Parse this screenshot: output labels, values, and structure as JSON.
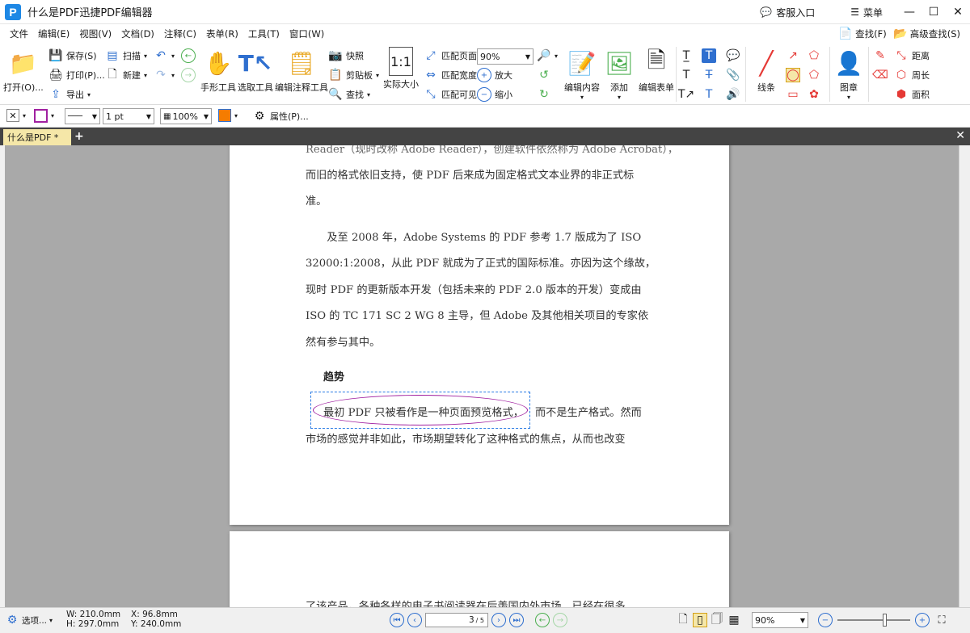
{
  "window": {
    "title": "什么是PDF迅捷PDF编辑器",
    "service_label": "客服入口",
    "menu_label": "菜单"
  },
  "menubar": {
    "items": [
      "文件",
      "编辑(E)",
      "视图(V)",
      "文档(D)",
      "注释(C)",
      "表单(R)",
      "工具(T)",
      "窗口(W)"
    ],
    "find": "查找(F)",
    "advanced_find": "高级查找(S)"
  },
  "ribbon": {
    "open": "打开(O)...",
    "save": "保存(S)",
    "print": "打印(P)...",
    "export": "导出",
    "scan": "扫描",
    "new": "新建",
    "hand_tool": "手形工具",
    "select_tool": "选取工具",
    "edit_annot_tool": "编辑注释工具",
    "snapshot": "快照",
    "clipboard": "剪贴板",
    "find": "查找",
    "actual_size": "实际大小",
    "fit_page": "匹配页面",
    "fit_width": "匹配宽度",
    "fit_visible": "匹配可见",
    "zoom_value": "90%",
    "zoom_in": "放大",
    "zoom_out": "缩小",
    "edit_content": "编辑内容",
    "add": "添加",
    "edit_form": "编辑表单",
    "lines": "线条",
    "stamp": "图章",
    "distance": "距离",
    "perimeter": "周长",
    "area": "面积"
  },
  "format_bar": {
    "line_width": "1 pt",
    "opacity": "100%",
    "properties": "属性(P)..."
  },
  "tab": {
    "label": "什么是PDF *"
  },
  "document": {
    "page1_lines": [
      "Reader（现时改称 Adobe Reader），创建软件依然称为 Adobe Acrobat），",
      "而旧的格式依旧支持，使 PDF 后来成为固定格式文本业界的非正式标",
      "准。",
      "　　及至 2008 年，Adobe Systems 的 PDF 参考 1.7 版成为了 ISO",
      "32000:1:2008，从此 PDF 就成为了正式的国际标准。亦因为这个缘故，",
      "现时 PDF 的更新版本开发（包括未来的 PDF 2.0 版本的开发）变成由",
      "ISO 的 TC 171 SC 2 WG 8 主导，但 Adobe 及其他相关项目的专家依",
      "然有参与其中。"
    ],
    "heading": "趋势",
    "para_line1_annotated": "最初 PDF 只被看作是一种页面预览格式，",
    "para_line1_rest": "而不是生产格式。然而",
    "para_line2": "市场的感觉并非如此，市场期望转化了这种格式的焦点，从而也改变",
    "page2_line": "了该产品。各种各样的电子书阅读器在后羡国内外市场，已经在很多"
  },
  "statusbar": {
    "options": "选项...",
    "width": "W: 210.0mm",
    "height": "H: 297.0mm",
    "x": "X:   96.8mm",
    "y": "Y: 240.0mm",
    "page_current": "3",
    "page_total": "/ 5",
    "zoom": "90%"
  },
  "colors": {
    "accent": "#2f6fcf",
    "tab_bg": "#f5e7a8",
    "oval": "#a020a0",
    "canvas": "#a9a9a9"
  }
}
